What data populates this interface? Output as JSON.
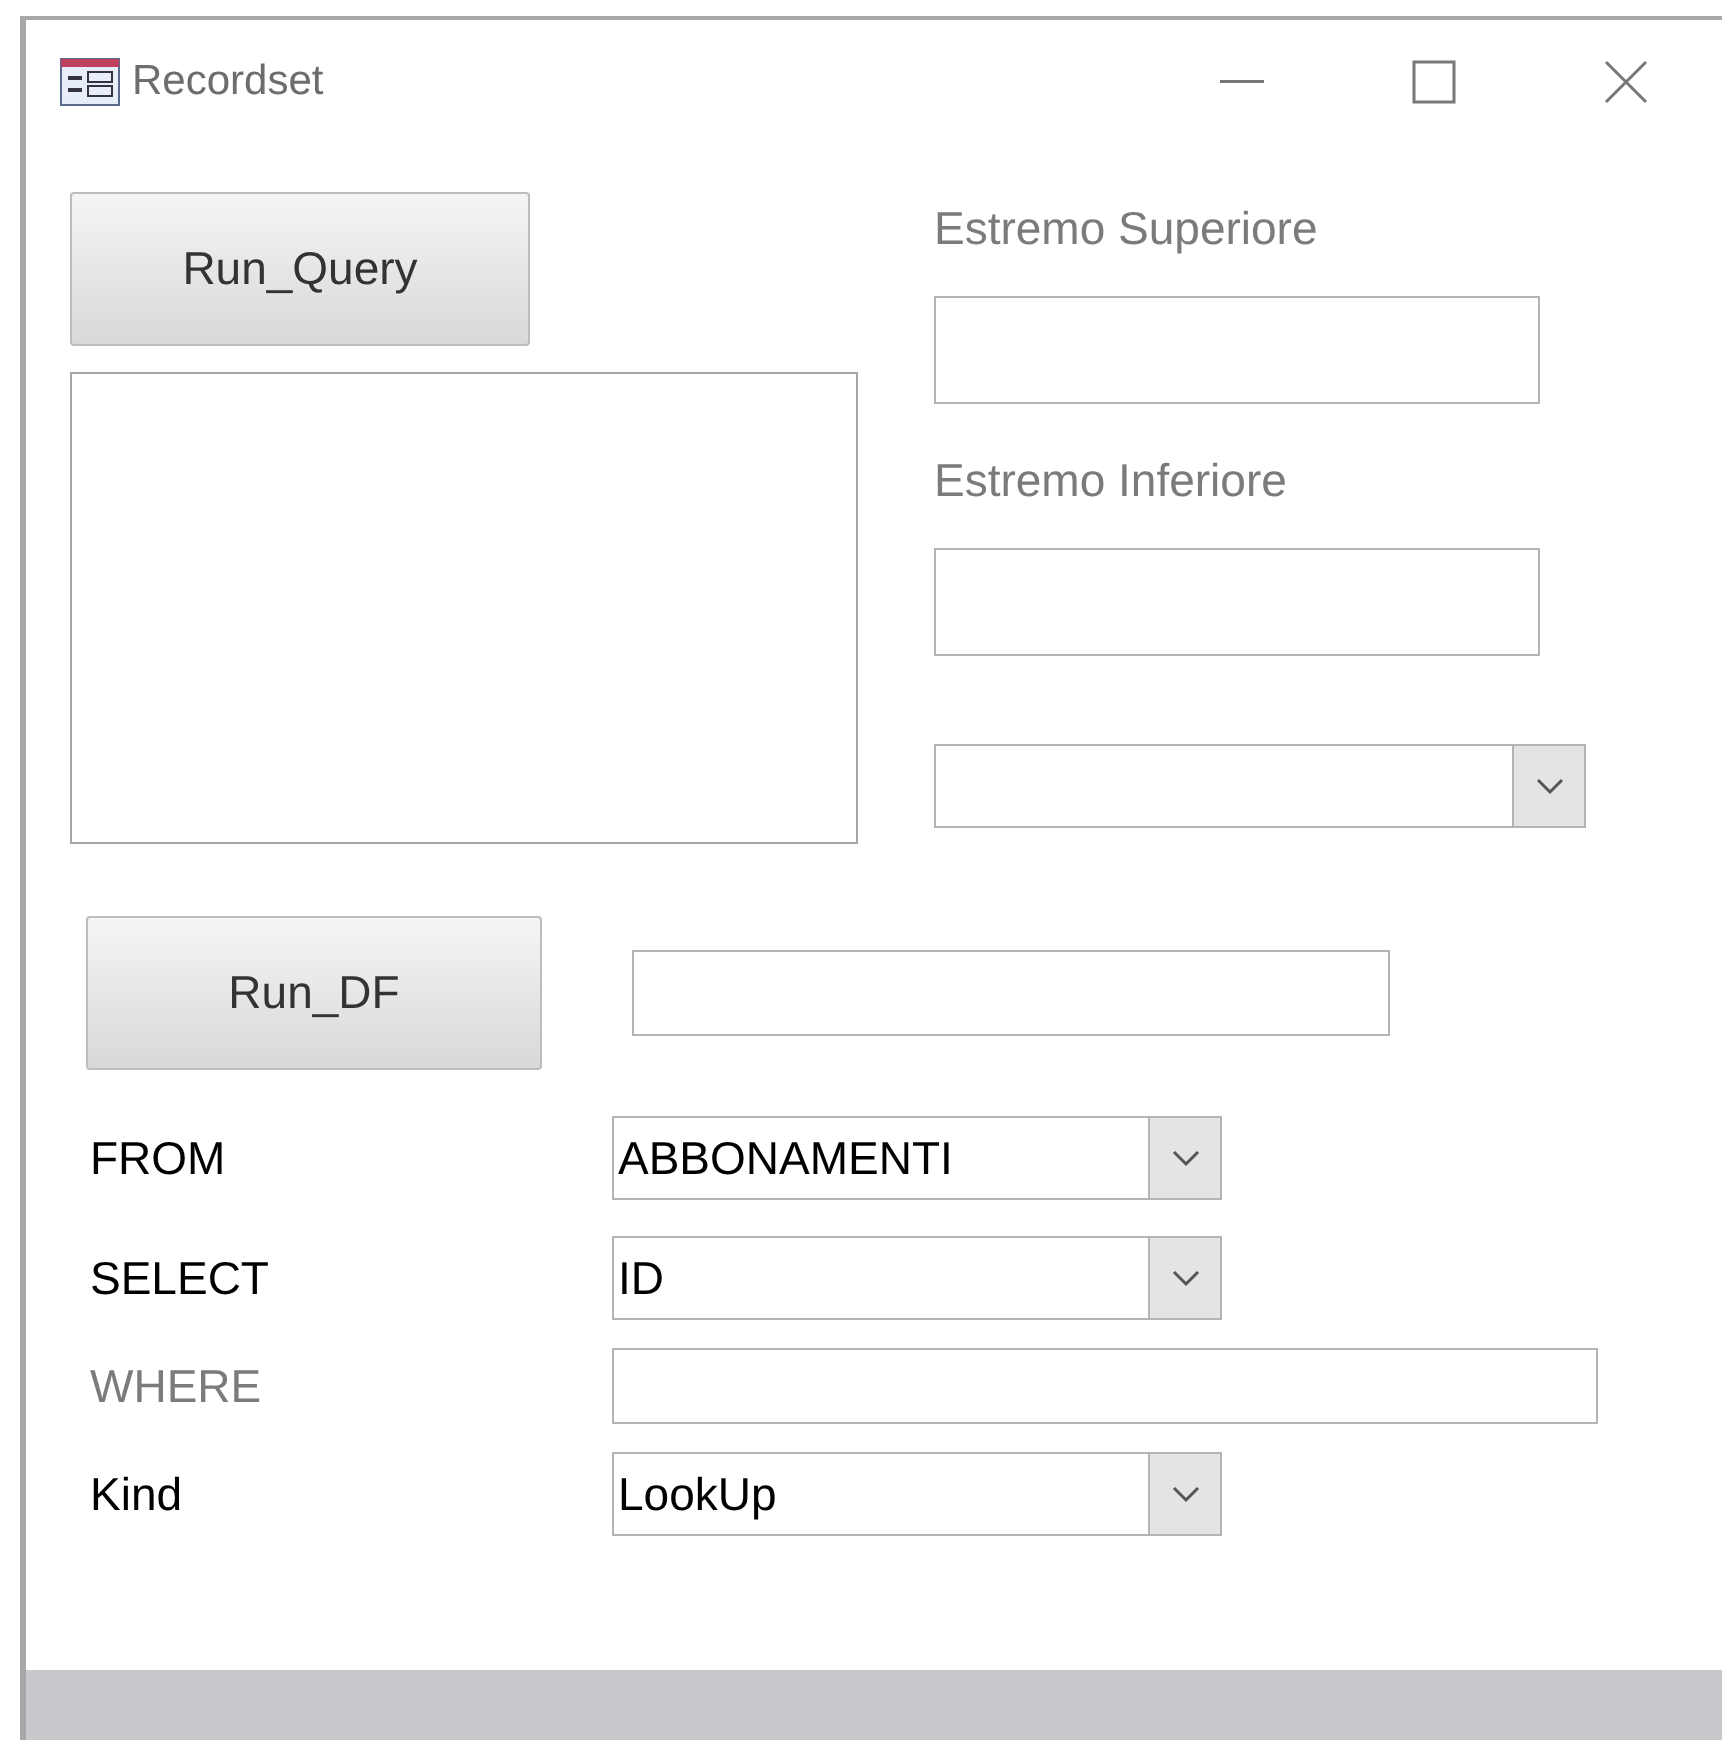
{
  "window": {
    "title": "Recordset"
  },
  "run_query_button": {
    "label": "Run_Query"
  },
  "bounds": [
    {
      "label": "Estremo Superiore",
      "disabled": true
    },
    {
      "label": "Estremo Inferiore",
      "disabled": true
    }
  ],
  "run_df_button": {
    "label": "Run_DF"
  },
  "query_fields": [
    {
      "label": "FROM",
      "kind": "combo",
      "value": "ABBONAMENTI",
      "disabled": false
    },
    {
      "label": "SELECT",
      "kind": "combo",
      "value": "ID",
      "disabled": false
    },
    {
      "label": "WHERE",
      "kind": "text",
      "disabled": true
    },
    {
      "label": "Kind",
      "kind": "combo",
      "value": "LookUp",
      "disabled": false
    }
  ]
}
